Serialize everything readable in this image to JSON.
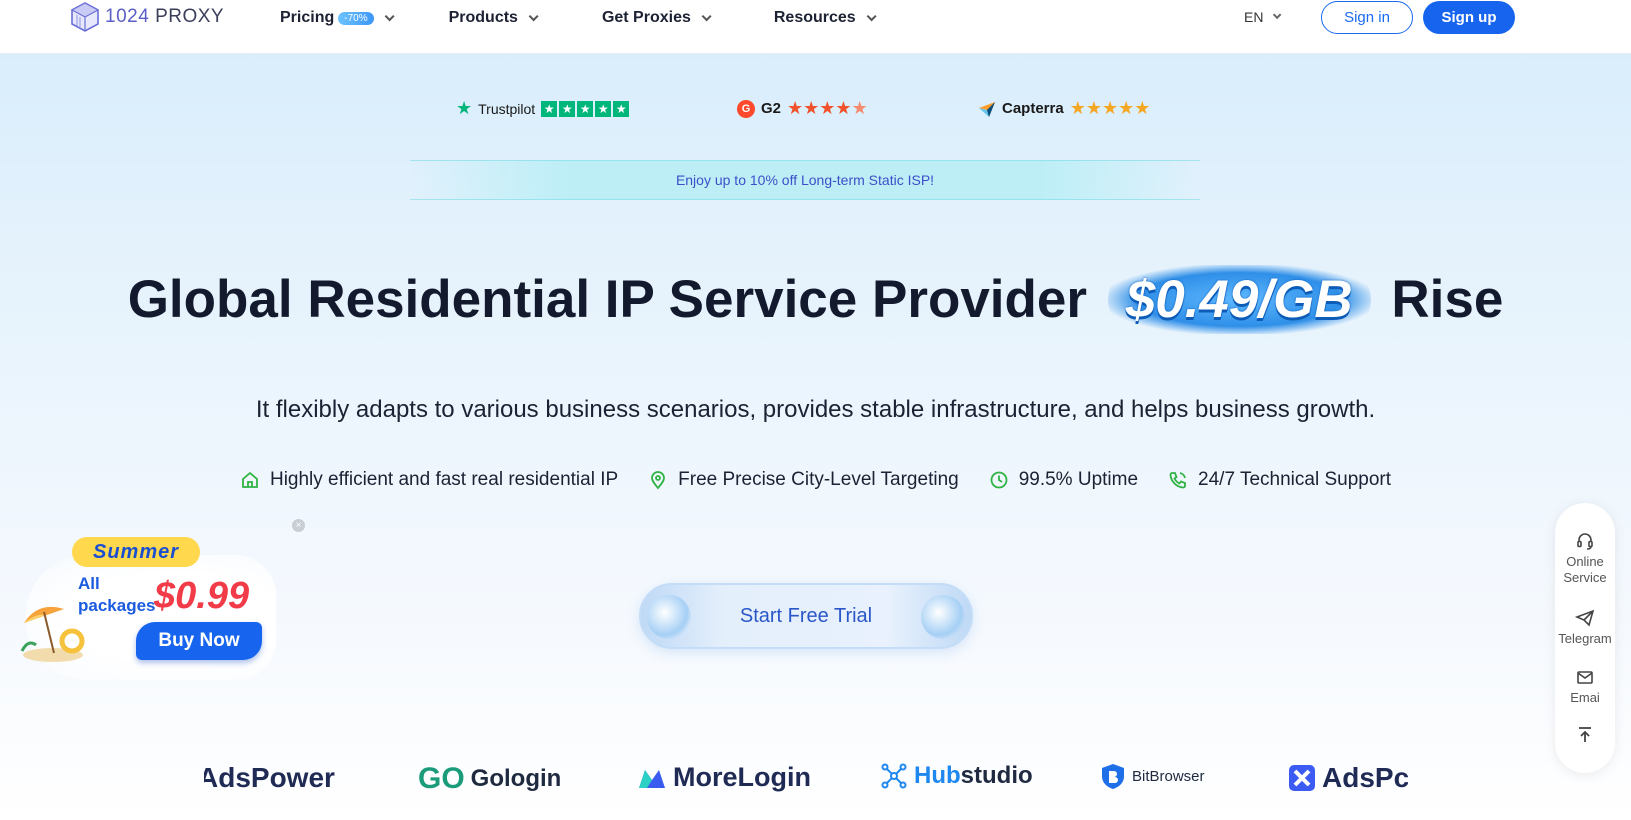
{
  "header": {
    "logo": {
      "number": "1024",
      "name": "PROXY"
    },
    "nav": [
      {
        "label": "Pricing",
        "badge": "-70%"
      },
      {
        "label": "Products"
      },
      {
        "label": "Get Proxies"
      },
      {
        "label": "Resources"
      }
    ],
    "language": "EN",
    "signin_label": "Sign in",
    "signup_label": "Sign up"
  },
  "ratings": {
    "trustpilot": {
      "name": "Trustpilot",
      "stars": 5
    },
    "g2": {
      "name": "G2",
      "stars": 4.5
    },
    "capterra": {
      "name": "Capterra",
      "stars": 5
    }
  },
  "promo_banner": "Enjoy up to 10% off Long-term Static ISP!",
  "hero": {
    "title_before": "Global Residential IP Service Provider",
    "price": "$0.49/GB",
    "title_after": "Rise",
    "subtitle": "It flexibly adapts to various business scenarios, provides stable infrastructure, and helps business growth."
  },
  "features": [
    {
      "icon": "home-icon",
      "label": "Highly efficient and fast real residential IP"
    },
    {
      "icon": "location-pin-icon",
      "label": "Free Precise City-Level Targeting"
    },
    {
      "icon": "clock-icon",
      "label": "99.5% Uptime"
    },
    {
      "icon": "phone-icon",
      "label": "24/7 Technical Support"
    }
  ],
  "cta_label": "Start Free Trial",
  "summer_promo": {
    "tag": "Summer",
    "line1": "All",
    "line2": "packages",
    "price": "$0.99",
    "button": "Buy Now"
  },
  "sidebar": {
    "online_line1": "Online",
    "online_line2": "Service",
    "telegram": "Telegram",
    "email": "Emai"
  },
  "partners": {
    "adspower_left": "AdsPower",
    "gologin": "Gologin",
    "morelogin": "MoreLogin",
    "hubstudio_hub": "Hub",
    "hubstudio_studio": "studio",
    "bitbrowser": "BitBrowser",
    "adspower_right": "AdsPc"
  },
  "colors": {
    "primary": "#1764ee",
    "promo_text": "#3d4fc8",
    "price_red": "#f13b48",
    "feature_icon": "#2fb344"
  }
}
